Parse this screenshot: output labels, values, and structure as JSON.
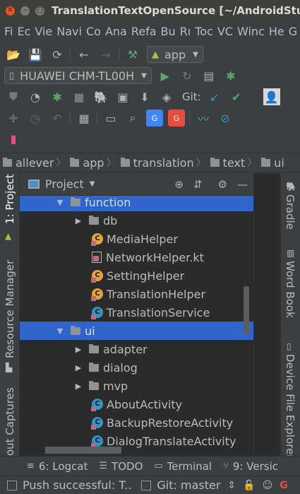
{
  "window": {
    "title": "TranslationTextOpenSource [~/AndroidStudioProjects/TranslationTextOpenSource]"
  },
  "menu": [
    "Fi",
    "Ec",
    "Vie",
    "Navi",
    "Co",
    "Ana",
    "Refa",
    "Bu",
    "Rı",
    "Toc",
    "VC",
    "Winc",
    "He",
    "G"
  ],
  "toolbar": {
    "run_config": "app",
    "device": "HUAWEI CHM-TL00H",
    "git_label": "Git:"
  },
  "breadcrumb": [
    "allever",
    "app",
    "translation",
    "text",
    "ui"
  ],
  "left_tabs": {
    "project": "1: Project",
    "resource_manager": "Resource Manager",
    "captures": "out Captures"
  },
  "right_tabs": {
    "gradle": "Gradle",
    "word_book": "Word Book",
    "device_explorer": "Device File Explorer"
  },
  "project_panel": {
    "title": "Project"
  },
  "tree": {
    "function": "function",
    "db": "db",
    "media_helper": "MediaHelper",
    "network_helper": "NetworkHelper.kt",
    "setting_helper": "SettingHelper",
    "translation_helper": "TranslationHelper",
    "translation_service": "TranslationService",
    "ui": "ui",
    "adapter": "adapter",
    "dialog": "dialog",
    "mvp": "mvp",
    "about_activity": "AboutActivity",
    "backup_restore_activity": "BackupRestoreActivity",
    "dialog_translate_activity": "DialogTranslateActivity"
  },
  "bottom_tools": {
    "logcat": "6: Logcat",
    "todo": "TODO",
    "terminal": "Terminal",
    "version": "9: Versic"
  },
  "status": {
    "message": "Push successful: T..",
    "git_branch": "Git: master"
  },
  "colors": {
    "selection": "#2f65ca",
    "run_green": "#59a869",
    "build_green": "#499c54",
    "vcs_blue": "#3592c4"
  }
}
